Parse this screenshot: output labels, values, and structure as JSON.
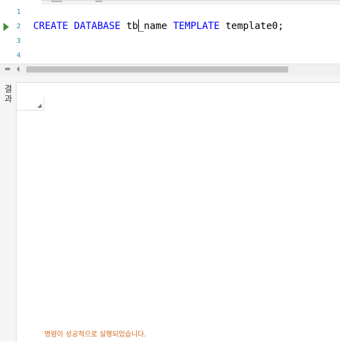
{
  "editor": {
    "lines": [
      {
        "number": "1"
      },
      {
        "number": "2",
        "tokens": {
          "create": "CREATE",
          "database": "DATABASE",
          "name_before_cursor": "tb",
          "name_after_cursor": "_name",
          "template_kw": "TEMPLATE",
          "template_value": "template0;"
        }
      },
      {
        "number": "3"
      },
      {
        "number": "4"
      }
    ],
    "colors": {
      "keyword": "#0000ff",
      "line_number": "#2b91af",
      "run_marker": "#3e8f3e"
    }
  },
  "results": {
    "tab_label": "결과",
    "message": "명령이 성공적으로 실행되었습니다.",
    "colors": {
      "message": "#d2691e"
    }
  },
  "icons": {
    "run_marker": "play-arrow-icon",
    "split": "split-handle-icon",
    "scroll_left": "scroll-left-arrow-icon",
    "grid_corner": "grid-select-all-icon"
  }
}
